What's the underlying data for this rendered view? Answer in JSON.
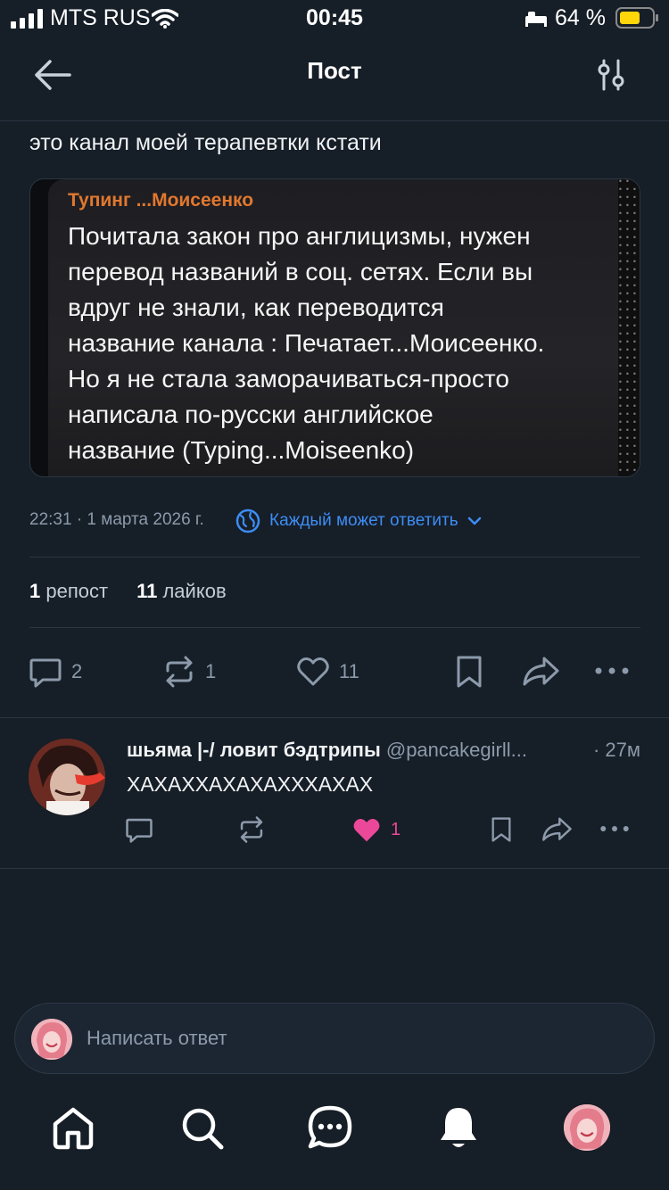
{
  "status_bar": {
    "carrier": "MTS RUS",
    "time": "00:45",
    "battery": "64 %"
  },
  "header": {
    "title": "Пост"
  },
  "post": {
    "text": "это канал моей терапевтки кстати",
    "image": {
      "author": "Тупинг ...Моисеенко",
      "lines": [
        "Почитала закон про англицизмы, нужен",
        "перевод названий в соц. сетях. Если вы",
        "вдруг не знали, как переводится",
        "название канала : Печатает...Моисеенко.",
        "Но я не стала заморачиваться-просто",
        "написала по-русски английское",
        "название (Typing...Moiseenko)"
      ]
    },
    "timestamp": "22:31 · 1 марта 2026 г.",
    "reply_permission": "Каждый может ответить",
    "reposts_count": "1",
    "reposts_label": "репост",
    "likes_count": "11",
    "likes_label": "лайков",
    "actions": {
      "replies": "2",
      "reposts": "1",
      "likes": "11"
    }
  },
  "reply": {
    "name": "шьяма |-/ ловит бэдтрипы",
    "handle": "@pancakegirll...",
    "time": "· 27м",
    "text": "ХАХАХХАХАХАХХХАХАХ",
    "likes": "1",
    "like_color": "#ec4899"
  },
  "compose": {
    "placeholder": "Написать ответ"
  },
  "colors": {
    "background": "#161e27",
    "accent": "#3d8df5",
    "muted": "#8c9aab"
  },
  "icons": {
    "header_left": "back-arrow-icon",
    "header_right": "settings-sliders-icon",
    "nav": [
      "home-icon",
      "search-icon",
      "chat-icon",
      "bell-icon",
      "profile-avatar"
    ]
  }
}
